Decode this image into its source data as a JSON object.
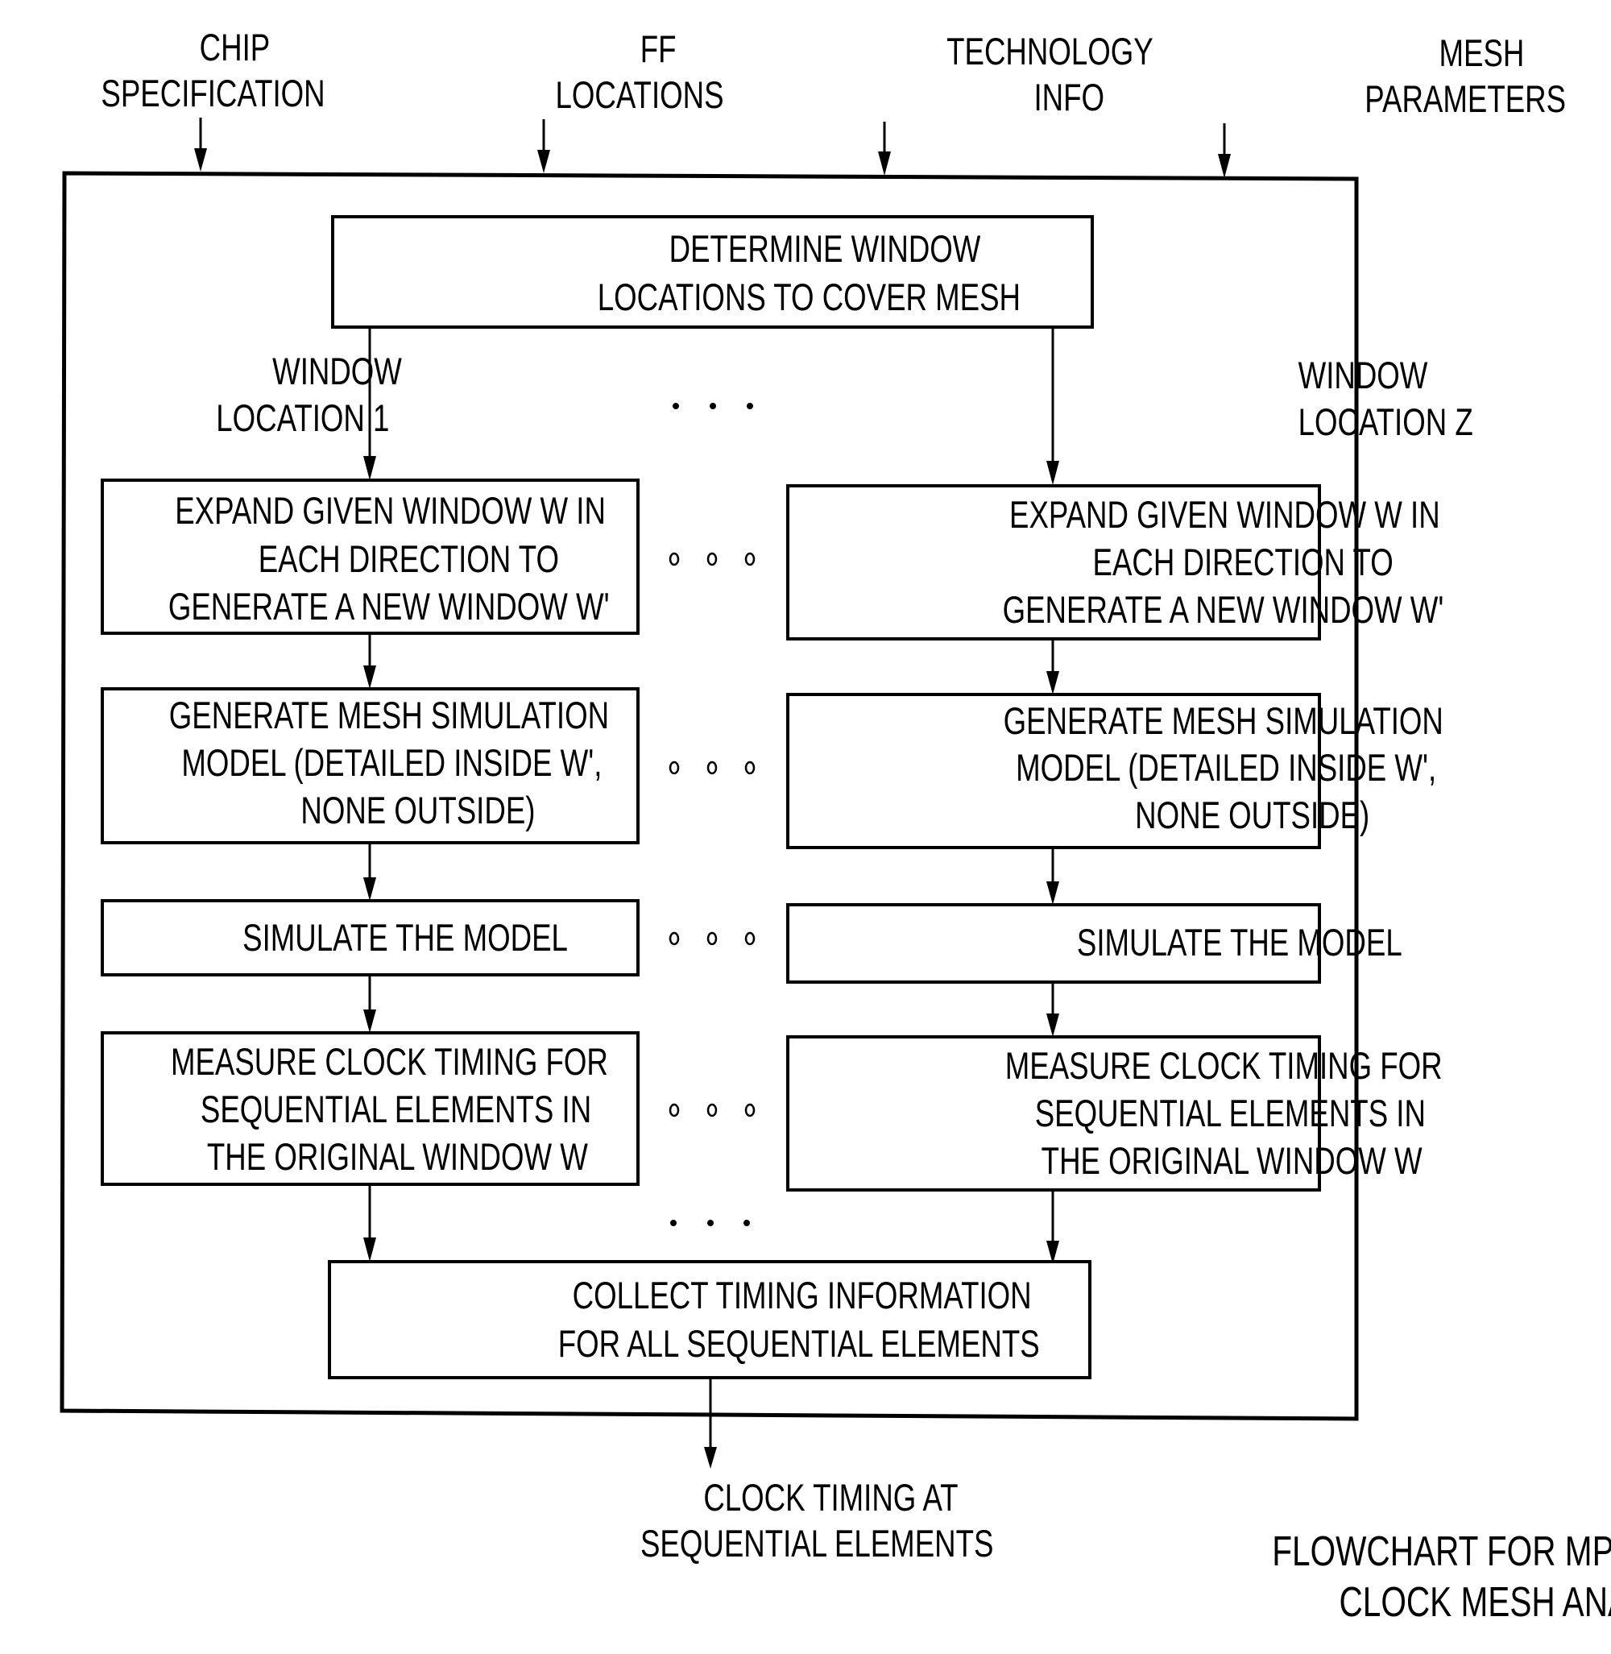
{
  "inputs": [
    {
      "id": "chip-specification",
      "lines": [
        "CHIP",
        "SPECIFICATION"
      ]
    },
    {
      "id": "ff-locations",
      "lines": [
        "FF",
        "LOCATIONS"
      ]
    },
    {
      "id": "technology-info",
      "lines": [
        "TECHNOLOGY",
        "INFO"
      ]
    },
    {
      "id": "mesh-parameters",
      "lines": [
        "MESH",
        "PARAMETERS"
      ]
    }
  ],
  "top_step": {
    "lines": [
      "DETERMINE WINDOW",
      "LOCATIONS TO COVER MESH"
    ]
  },
  "branch_labels": {
    "left": [
      "WINDOW",
      "LOCATION 1"
    ],
    "right": [
      "WINDOW",
      "LOCATION Z"
    ]
  },
  "column_steps": [
    {
      "id": "expand-window",
      "lines": [
        "EXPAND GIVEN WINDOW W IN",
        "EACH DIRECTION TO",
        "GENERATE A NEW WINDOW W'"
      ]
    },
    {
      "id": "generate-model",
      "lines": [
        "GENERATE MESH SIMULATION",
        "MODEL (DETAILED INSIDE W',",
        "NONE OUTSIDE)"
      ]
    },
    {
      "id": "simulate-model",
      "lines": [
        "SIMULATE THE MODEL"
      ]
    },
    {
      "id": "measure-timing",
      "lines": [
        "MEASURE CLOCK TIMING FOR",
        "SEQUENTIAL ELEMENTS IN",
        "THE ORIGINAL WINDOW W"
      ]
    }
  ],
  "collect_step": {
    "lines": [
      "COLLECT TIMING INFORMATION",
      "FOR ALL SEQUENTIAL ELEMENTS"
    ]
  },
  "output": {
    "lines": [
      "CLOCK TIMING AT",
      "SEQUENTIAL ELEMENTS"
    ]
  },
  "caption": {
    "lines": [
      "FLOWCHART FOR MPS-BASED",
      "CLOCK MESH ANALYSIS"
    ]
  },
  "ellipsis_symbol": "• • •"
}
